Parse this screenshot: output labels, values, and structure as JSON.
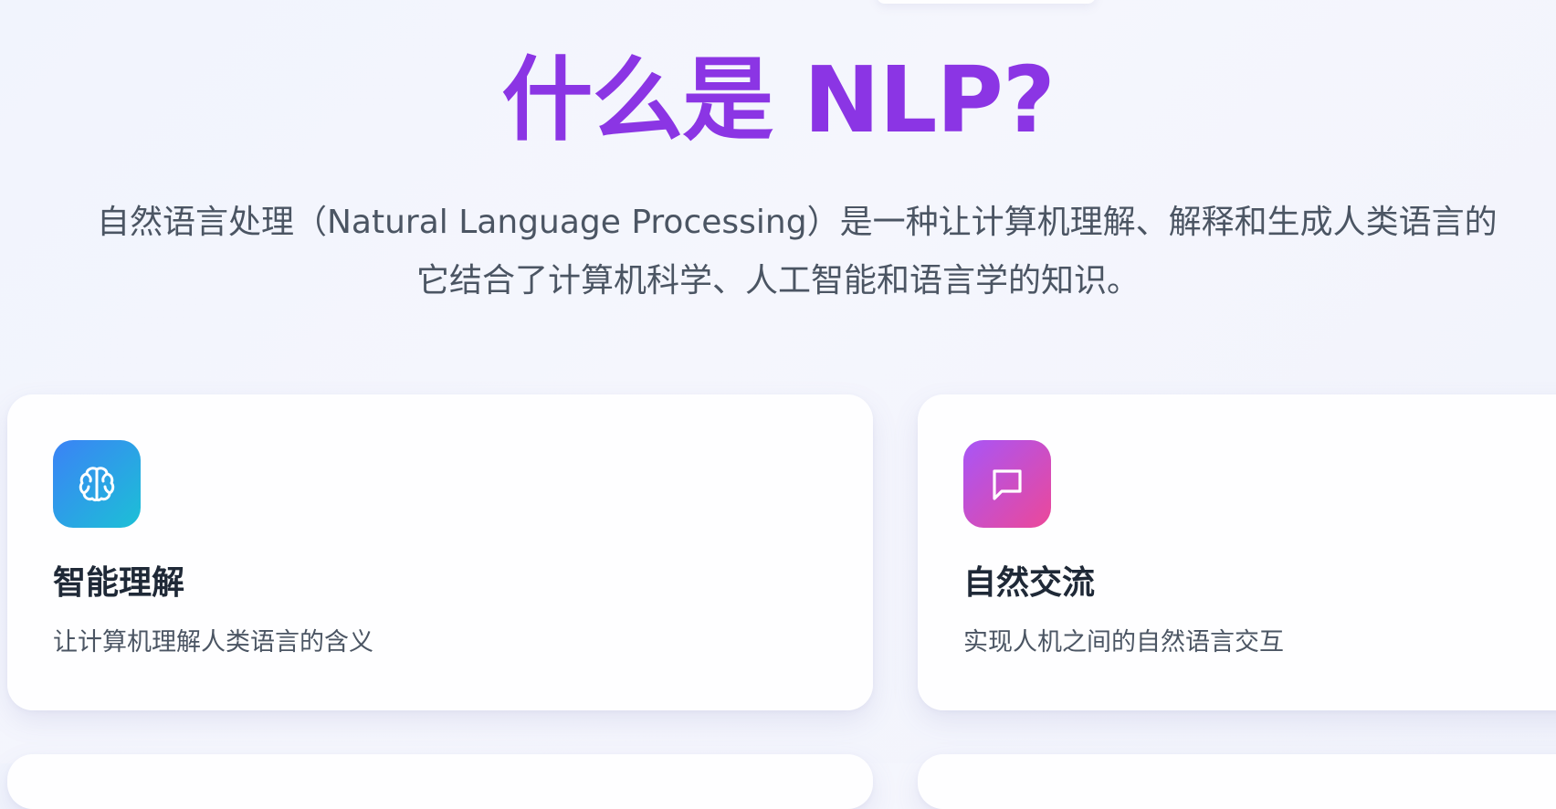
{
  "header": {
    "title": "什么是 NLP?"
  },
  "intro": {
    "line1": "自然语言处理（Natural Language Processing）是一种让计算机理解、解释和生成人类语言的",
    "line2": "它结合了计算机科学、人工智能和语言学的知识。"
  },
  "cards": [
    {
      "icon": "brain-icon",
      "title": "智能理解",
      "description": "让计算机理解人类语言的含义",
      "icon_gradient": [
        "#3b82f6",
        "#1cc0d6"
      ]
    },
    {
      "icon": "chat-bubble-icon",
      "title": "自然交流",
      "description": "实现人机之间的自然语言交互",
      "icon_gradient": [
        "#a855f7",
        "#ec4899"
      ]
    }
  ],
  "colors": {
    "title": "#8b35e4",
    "body_text": "#4b5563",
    "card_title": "#1f2937"
  }
}
